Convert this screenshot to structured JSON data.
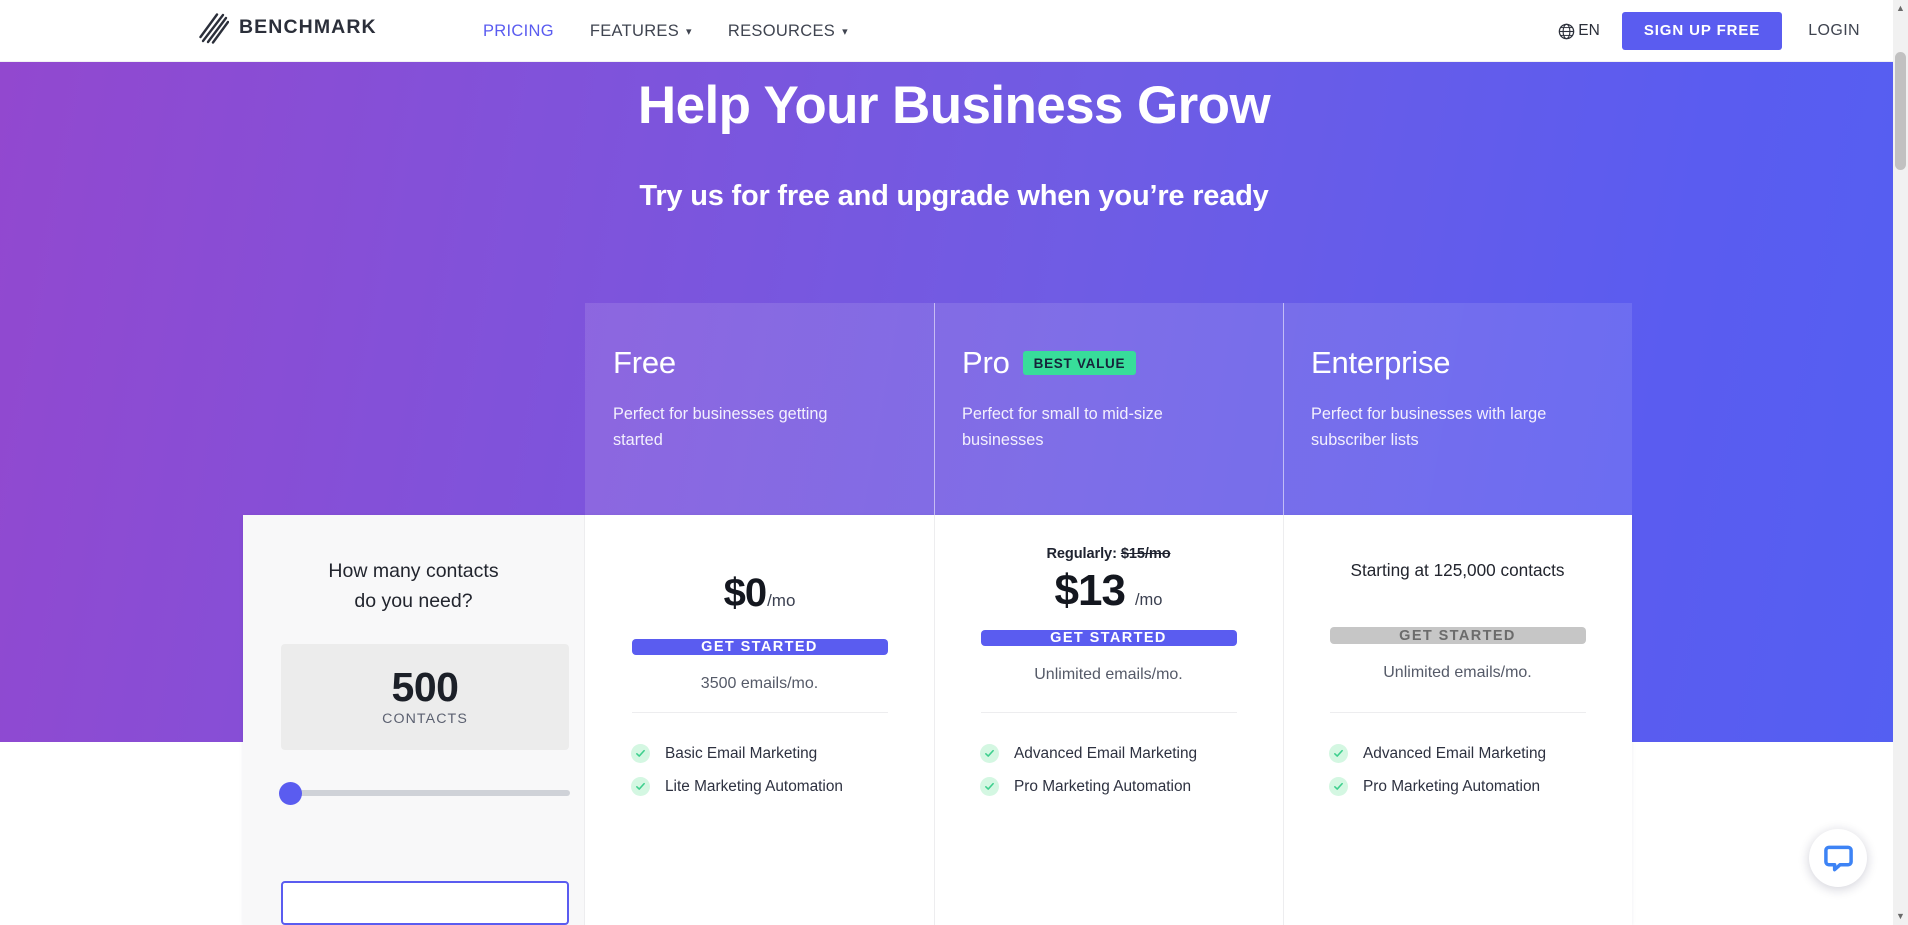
{
  "header": {
    "brand": "BENCHMARK",
    "nav": [
      {
        "label": "PRICING",
        "caret": "",
        "active": true
      },
      {
        "label": "FEATURES",
        "caret": "⌄",
        "active": false
      },
      {
        "label": "RESOURCES",
        "caret": "⌄",
        "active": false
      }
    ],
    "language": "EN",
    "signup_label": "SIGN UP FREE",
    "login_label": "LOGIN",
    "accent_color": "#5a5cf0"
  },
  "hero": {
    "title": "Help Your Business Grow",
    "subtitle": "Try us for free and upgrade when you’re ready"
  },
  "calculator": {
    "question": "How many contacts\ndo you need?",
    "question_line1": "How many contacts",
    "question_line2": "do you need?",
    "value": "500",
    "unit_label": "CONTACTS",
    "slider_percent": 0
  },
  "plans": [
    {
      "name": "Free",
      "badge": "",
      "description": "Perfect for businesses getting started",
      "regularly": "",
      "regularly_struck": "",
      "price": "$0",
      "price_suffix": "/mo",
      "enterprise_note": "",
      "cta_label": "GET STARTED",
      "cta_disabled": false,
      "emails": "3500 emails/mo.",
      "features": [
        "Basic Email Marketing",
        "Lite Marketing Automation"
      ]
    },
    {
      "name": "Pro",
      "badge": "BEST VALUE",
      "description": "Perfect for small to mid-size businesses",
      "regularly": "Regularly:",
      "regularly_struck": "$15/mo",
      "price": "$13",
      "price_suffix": "/mo",
      "enterprise_note": "",
      "cta_label": "GET STARTED",
      "cta_disabled": false,
      "emails": "Unlimited emails/mo.",
      "features": [
        "Advanced Email Marketing",
        "Pro Marketing Automation"
      ]
    },
    {
      "name": "Enterprise",
      "badge": "",
      "description": "Perfect for businesses with large subscriber lists",
      "regularly": "",
      "regularly_struck": "",
      "price": "",
      "price_suffix": "",
      "enterprise_note": "Starting at 125,000 contacts",
      "cta_label": "GET STARTED",
      "cta_disabled": true,
      "emails": "Unlimited emails/mo.",
      "features": [
        "Advanced Email Marketing",
        "Pro Marketing Automation"
      ]
    }
  ],
  "colors": {
    "brand_purple": "#9248cf",
    "brand_blue": "#5a5cf0",
    "badge_green": "#38dd9a",
    "check_green": "#3ecf8e",
    "disabled_gray": "#c6c6c6"
  },
  "chat": {
    "icon": "chat-bubble-icon"
  },
  "scrollbar": {
    "up": "▲",
    "down": "▼"
  }
}
